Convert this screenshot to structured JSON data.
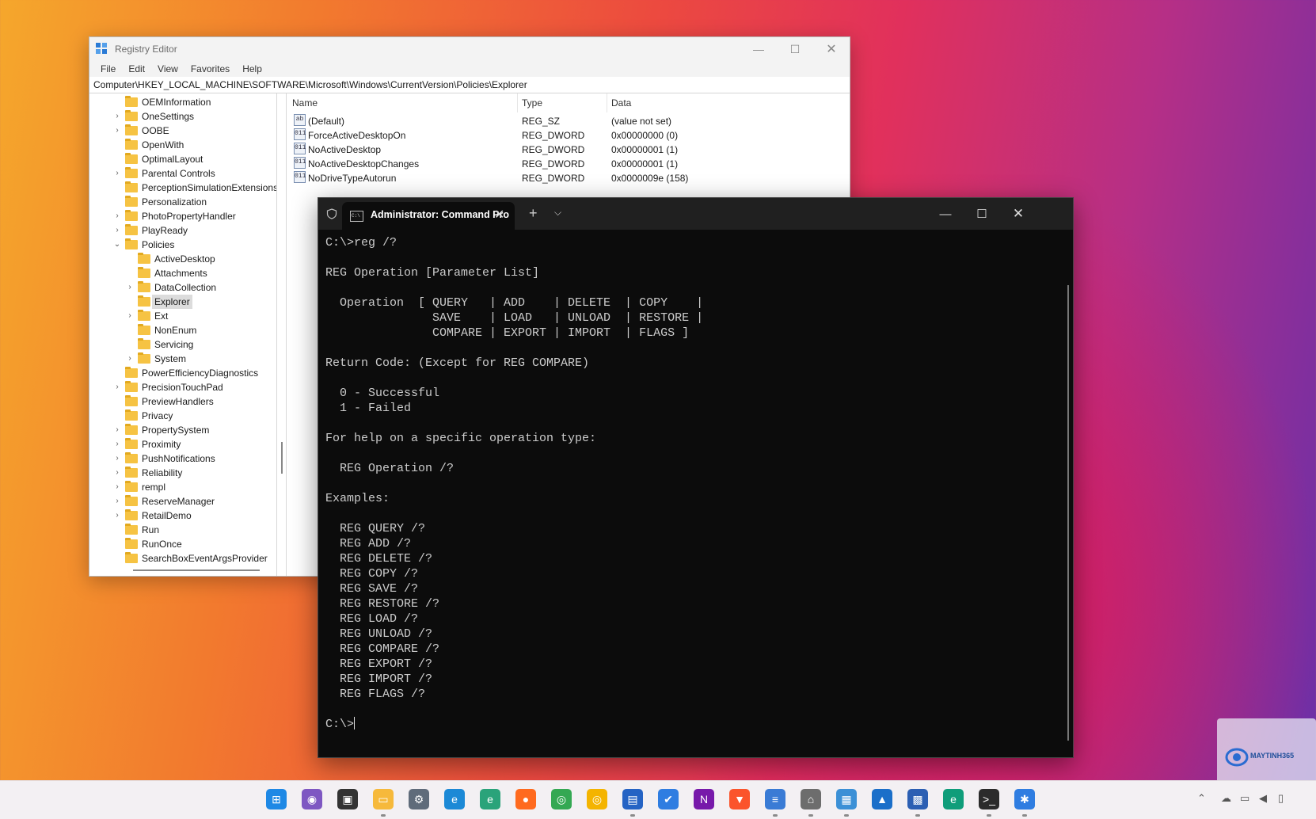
{
  "regedit": {
    "title": "Registry Editor",
    "menu": [
      "File",
      "Edit",
      "View",
      "Favorites",
      "Help"
    ],
    "address": "Computer\\HKEY_LOCAL_MACHINE\\SOFTWARE\\Microsoft\\Windows\\CurrentVersion\\Policies\\Explorer",
    "tree": [
      {
        "label": "OEMInformation",
        "level": 1,
        "arrow": ""
      },
      {
        "label": "OneSettings",
        "level": 1,
        "arrow": "›"
      },
      {
        "label": "OOBE",
        "level": 1,
        "arrow": "›"
      },
      {
        "label": "OpenWith",
        "level": 1,
        "arrow": ""
      },
      {
        "label": "OptimalLayout",
        "level": 1,
        "arrow": ""
      },
      {
        "label": "Parental Controls",
        "level": 1,
        "arrow": "›"
      },
      {
        "label": "PerceptionSimulationExtensions",
        "level": 1,
        "arrow": ""
      },
      {
        "label": "Personalization",
        "level": 1,
        "arrow": ""
      },
      {
        "label": "PhotoPropertyHandler",
        "level": 1,
        "arrow": "›"
      },
      {
        "label": "PlayReady",
        "level": 1,
        "arrow": "›"
      },
      {
        "label": "Policies",
        "level": 1,
        "arrow": "⌄"
      },
      {
        "label": "ActiveDesktop",
        "level": 2,
        "arrow": ""
      },
      {
        "label": "Attachments",
        "level": 2,
        "arrow": ""
      },
      {
        "label": "DataCollection",
        "level": 2,
        "arrow": "›"
      },
      {
        "label": "Explorer",
        "level": 2,
        "arrow": "",
        "selected": true
      },
      {
        "label": "Ext",
        "level": 2,
        "arrow": "›"
      },
      {
        "label": "NonEnum",
        "level": 2,
        "arrow": ""
      },
      {
        "label": "Servicing",
        "level": 2,
        "arrow": ""
      },
      {
        "label": "System",
        "level": 2,
        "arrow": "›"
      },
      {
        "label": "PowerEfficiencyDiagnostics",
        "level": 1,
        "arrow": ""
      },
      {
        "label": "PrecisionTouchPad",
        "level": 1,
        "arrow": "›"
      },
      {
        "label": "PreviewHandlers",
        "level": 1,
        "arrow": ""
      },
      {
        "label": "Privacy",
        "level": 1,
        "arrow": ""
      },
      {
        "label": "PropertySystem",
        "level": 1,
        "arrow": "›"
      },
      {
        "label": "Proximity",
        "level": 1,
        "arrow": "›"
      },
      {
        "label": "PushNotifications",
        "level": 1,
        "arrow": "›"
      },
      {
        "label": "Reliability",
        "level": 1,
        "arrow": "›"
      },
      {
        "label": "rempl",
        "level": 1,
        "arrow": "›"
      },
      {
        "label": "ReserveManager",
        "level": 1,
        "arrow": "›"
      },
      {
        "label": "RetailDemo",
        "level": 1,
        "arrow": "›"
      },
      {
        "label": "Run",
        "level": 1,
        "arrow": ""
      },
      {
        "label": "RunOnce",
        "level": 1,
        "arrow": ""
      },
      {
        "label": "SearchBoxEventArgsProvider",
        "level": 1,
        "arrow": ""
      }
    ],
    "columns": {
      "name": "Name",
      "type": "Type",
      "data": "Data"
    },
    "values": [
      {
        "icon": "ab",
        "name": "(Default)",
        "type": "REG_SZ",
        "data": "(value not set)"
      },
      {
        "icon": "011",
        "name": "ForceActiveDesktopOn",
        "type": "REG_DWORD",
        "data": "0x00000000 (0)"
      },
      {
        "icon": "011",
        "name": "NoActiveDesktop",
        "type": "REG_DWORD",
        "data": "0x00000001 (1)"
      },
      {
        "icon": "011",
        "name": "NoActiveDesktopChanges",
        "type": "REG_DWORD",
        "data": "0x00000001 (1)"
      },
      {
        "icon": "011",
        "name": "NoDriveTypeAutorun",
        "type": "REG_DWORD",
        "data": "0x0000009e (158)"
      }
    ]
  },
  "terminal": {
    "tab_title": "Administrator: Command Pro",
    "tab_icon_text": "C:\\",
    "lines": [
      "C:\\>reg /?",
      "",
      "REG Operation [Parameter List]",
      "",
      "  Operation  [ QUERY   | ADD    | DELETE  | COPY    |",
      "               SAVE    | LOAD   | UNLOAD  | RESTORE |",
      "               COMPARE | EXPORT | IMPORT  | FLAGS ]",
      "",
      "Return Code: (Except for REG COMPARE)",
      "",
      "  0 - Successful",
      "  1 - Failed",
      "",
      "For help on a specific operation type:",
      "",
      "  REG Operation /?",
      "",
      "Examples:",
      "",
      "  REG QUERY /?",
      "  REG ADD /?",
      "  REG DELETE /?",
      "  REG COPY /?",
      "  REG SAVE /?",
      "  REG RESTORE /?",
      "  REG LOAD /?",
      "  REG UNLOAD /?",
      "  REG COMPARE /?",
      "  REG EXPORT /?",
      "  REG IMPORT /?",
      "  REG FLAGS /?",
      ""
    ],
    "prompt": "C:\\>"
  },
  "watermark": {
    "text": "MAYTINH365"
  },
  "taskbar": {
    "items": [
      {
        "name": "start-icon",
        "color": "#1e88e5",
        "glyph": "⊞",
        "running": false
      },
      {
        "name": "copilot-icon",
        "color": "#7e57c2",
        "glyph": "◉",
        "running": false
      },
      {
        "name": "task-view-icon",
        "color": "#333333",
        "glyph": "▣",
        "running": false
      },
      {
        "name": "file-explorer-icon",
        "color": "#f6b93b",
        "glyph": "▭",
        "running": true
      },
      {
        "name": "settings-icon",
        "color": "#5f6b7a",
        "glyph": "⚙",
        "running": false
      },
      {
        "name": "edge-icon",
        "color": "#1c89d6",
        "glyph": "e",
        "running": false
      },
      {
        "name": "edge-canary-icon",
        "color": "#2aa37a",
        "glyph": "e",
        "running": false
      },
      {
        "name": "firefox-icon",
        "color": "#ff6a1e",
        "glyph": "●",
        "running": false
      },
      {
        "name": "chrome-icon",
        "color": "#34a853",
        "glyph": "◎",
        "running": false
      },
      {
        "name": "chrome-canary-icon",
        "color": "#f4b400",
        "glyph": "◎",
        "running": false
      },
      {
        "name": "store-icon",
        "color": "#2563c4",
        "glyph": "▤",
        "running": true
      },
      {
        "name": "todo-icon",
        "color": "#2f7de1",
        "glyph": "✔",
        "running": false
      },
      {
        "name": "onenote-icon",
        "color": "#7719aa",
        "glyph": "N",
        "running": false
      },
      {
        "name": "brave-icon",
        "color": "#fb542b",
        "glyph": "▼",
        "running": false
      },
      {
        "name": "notepad-icon",
        "color": "#3a7bd5",
        "glyph": "≡",
        "running": true
      },
      {
        "name": "network-tool-icon",
        "color": "#6d6d6d",
        "glyph": "⌂",
        "running": true
      },
      {
        "name": "remote-desktop-icon",
        "color": "#3c90d6",
        "glyph": "▦",
        "running": true
      },
      {
        "name": "photos-icon",
        "color": "#1b6fc9",
        "glyph": "▲",
        "running": false
      },
      {
        "name": "regedit-icon",
        "color": "#2c5fb3",
        "glyph": "▩",
        "running": true
      },
      {
        "name": "edge-dev-icon",
        "color": "#0f9d7a",
        "glyph": "e",
        "running": false
      },
      {
        "name": "terminal-icon",
        "color": "#2b2b2b",
        "glyph": ">_",
        "running": true
      },
      {
        "name": "dev-tool-icon",
        "color": "#2f7de1",
        "glyph": "✱",
        "running": true
      }
    ]
  }
}
